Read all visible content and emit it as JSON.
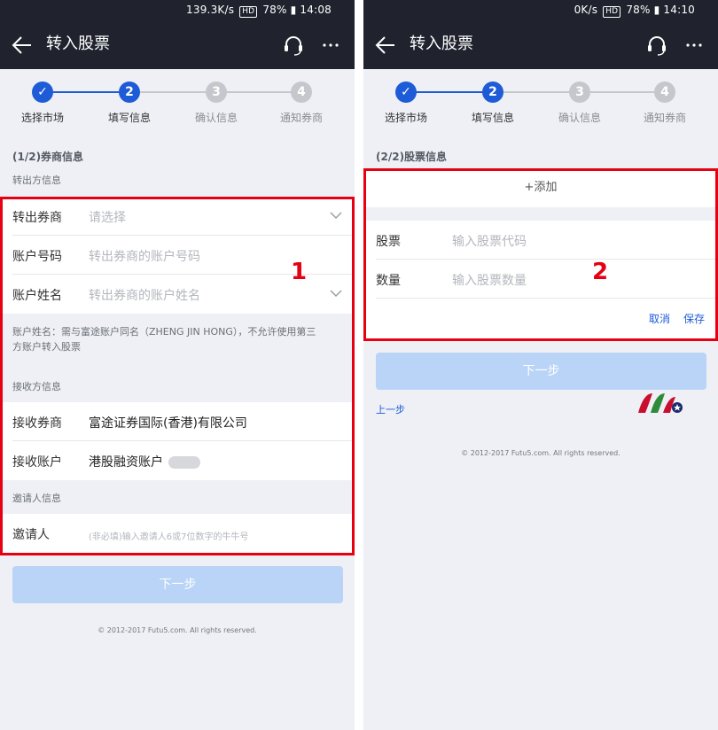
{
  "left": {
    "status_text": "139.3K/s ",
    "status_time": "78% ▮ 14:08",
    "hd": "HD",
    "title": "转入股票",
    "steps": [
      {
        "label": "选择市场",
        "num": "✓",
        "state": "done"
      },
      {
        "label": "填写信息",
        "num": "2",
        "state": "active"
      },
      {
        "label": "确认信息",
        "num": "3",
        "state": "pending"
      },
      {
        "label": "通知券商",
        "num": "4",
        "state": "pending"
      }
    ],
    "section_title": "(1/2)券商信息",
    "transfer_out_heading": "转出方信息",
    "rows_out": [
      {
        "label": "转出券商",
        "value": "请选择",
        "placeholder": true
      },
      {
        "label": "账户号码",
        "value": "转出券商的账户号码",
        "placeholder": true
      },
      {
        "label": "账户姓名",
        "value": "转出券商的账户姓名",
        "placeholder": true
      }
    ],
    "note": "账户姓名：需与富途账户同名（ZHENG JIN HONG），不允许使用第三方账户转入股票",
    "receive_heading": "接收方信息",
    "rows_in": [
      {
        "label": "接收券商",
        "value": "富途证券国际(香港)有限公司"
      },
      {
        "label": "接收账户",
        "value": "港股融资账户"
      }
    ],
    "inviter_heading": "邀请人信息",
    "inviter_label": "邀请人",
    "inviter_placeholder": "(非必填)输入邀请人6或7位数字的牛牛号",
    "next_label": "下一步",
    "copyright": "© 2012-2017 Futu5.com. All rights reserved.",
    "callout": "1"
  },
  "right": {
    "status_text": "0K/s ",
    "status_time": "78% ▮ 14:10",
    "hd": "HD",
    "title": "转入股票",
    "steps": [
      {
        "label": "选择市场",
        "num": "✓",
        "state": "done"
      },
      {
        "label": "填写信息",
        "num": "2",
        "state": "active"
      },
      {
        "label": "确认信息",
        "num": "3",
        "state": "pending"
      },
      {
        "label": "通知券商",
        "num": "4",
        "state": "pending"
      }
    ],
    "section_title": "(2/2)股票信息",
    "add_label": "+添加",
    "rows": [
      {
        "label": "股票",
        "value": "输入股票代码"
      },
      {
        "label": "数量",
        "value": "输入股票数量"
      }
    ],
    "cancel_label": "取消",
    "save_label": "保存",
    "next_label": "下一步",
    "prev_label": "上一步",
    "copyright": "© 2012-2017 Futu5.com. All rights reserved.",
    "callout": "2"
  },
  "colors": {
    "nav": "#20232e",
    "accent": "#1e5bd6",
    "highlight": "#e60012",
    "disabled_button": "#b9d4f6"
  }
}
